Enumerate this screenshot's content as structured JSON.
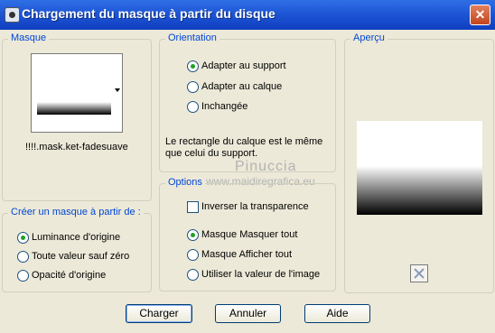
{
  "window": {
    "title": "Chargement du masque à partir du disque"
  },
  "masque": {
    "legend": "Masque",
    "filename": "!!!!.mask.ket-fadesuave"
  },
  "creer": {
    "legend": "Créer un masque à partir de :",
    "options": [
      {
        "label": "Luminance d'origine",
        "checked": true
      },
      {
        "label": "Toute valeur sauf zéro",
        "checked": false
      },
      {
        "label": "Opacité d'origine",
        "checked": false
      }
    ]
  },
  "orientation": {
    "legend": "Orientation",
    "options": [
      {
        "label": "Adapter au support",
        "checked": true
      },
      {
        "label": "Adapter au calque",
        "checked": false
      },
      {
        "label": "Inchangée",
        "checked": false
      }
    ],
    "description_line1": "Le rectangle du calque est le même",
    "description_line2": "que celui du support."
  },
  "options": {
    "legend": "Options",
    "invert_label": "Inverser la transparence",
    "invert_checked": false,
    "radios": [
      {
        "label": "Masque Masquer tout",
        "checked": true
      },
      {
        "label": "Masque Afficher tout",
        "checked": false
      },
      {
        "label": "Utiliser la valeur de l'image",
        "checked": false
      }
    ]
  },
  "apercu": {
    "legend": "Aperçu"
  },
  "buttons": {
    "charger": "Charger",
    "annuler": "Annuler",
    "aide": "Aide"
  },
  "watermark": {
    "line1": "Pinuccia",
    "line2": "www.maidiregrafica.eu"
  }
}
